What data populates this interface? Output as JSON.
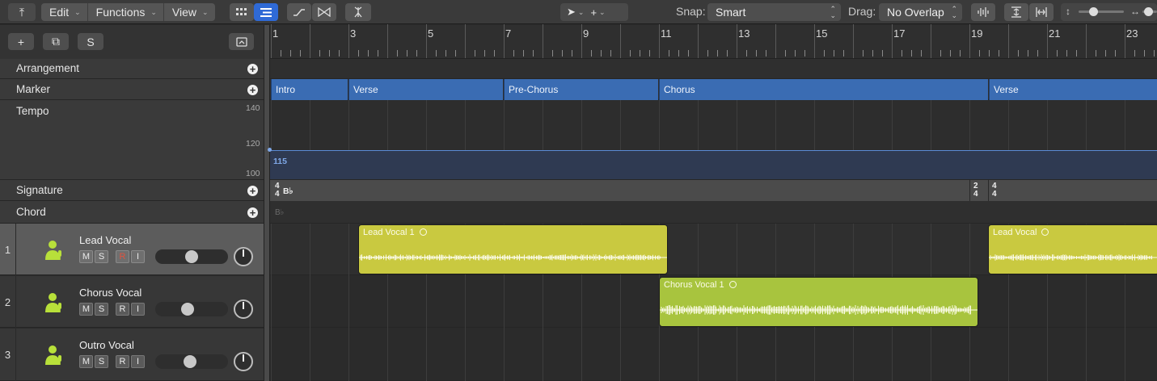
{
  "toolbar": {
    "menus": [
      {
        "label": "Edit"
      },
      {
        "label": "Functions"
      },
      {
        "label": "View"
      }
    ],
    "snap_label": "Snap:",
    "snap_value": "Smart",
    "drag_label": "Drag:",
    "drag_value": "No Overlap"
  },
  "header_buttons": {
    "add": "+",
    "duplicate": "⧉",
    "s": "S"
  },
  "ruler": {
    "bars": [
      "1",
      "3",
      "5",
      "7",
      "9",
      "11",
      "13",
      "15",
      "17",
      "19",
      "21",
      "23"
    ]
  },
  "global_tracks": {
    "arrangement": "Arrangement",
    "marker": "Marker",
    "tempo": "Tempo",
    "signature": "Signature",
    "chord": "Chord"
  },
  "markers": [
    {
      "name": "Intro"
    },
    {
      "name": "Verse"
    },
    {
      "name": "Pre-Chorus"
    },
    {
      "name": "Chorus"
    },
    {
      "name": "Verse"
    }
  ],
  "tempo": {
    "scale": [
      "140",
      "120",
      "100"
    ],
    "value": "115"
  },
  "signature": {
    "start_num": "4",
    "start_den": "4",
    "key": "B♭",
    "change1_num": "2",
    "change1_den": "4",
    "change2_num": "4",
    "change2_den": "4"
  },
  "chord": {
    "key": "B♭"
  },
  "tracks": [
    {
      "number": "1",
      "name": "Lead Vocal",
      "m": "M",
      "s": "S",
      "r": "R",
      "i": "I"
    },
    {
      "number": "2",
      "name": "Chorus Vocal",
      "m": "M",
      "s": "S",
      "r": "R",
      "i": "I"
    },
    {
      "number": "3",
      "name": "Outro Vocal",
      "m": "M",
      "s": "S",
      "r": "R",
      "i": "I"
    }
  ],
  "regions": [
    {
      "name": "Lead Vocal 1",
      "color": "#c9c940"
    },
    {
      "name": "Lead Vocal",
      "color": "#c9c940"
    },
    {
      "name": "Chorus Vocal 1",
      "color": "#a8c43e"
    }
  ]
}
